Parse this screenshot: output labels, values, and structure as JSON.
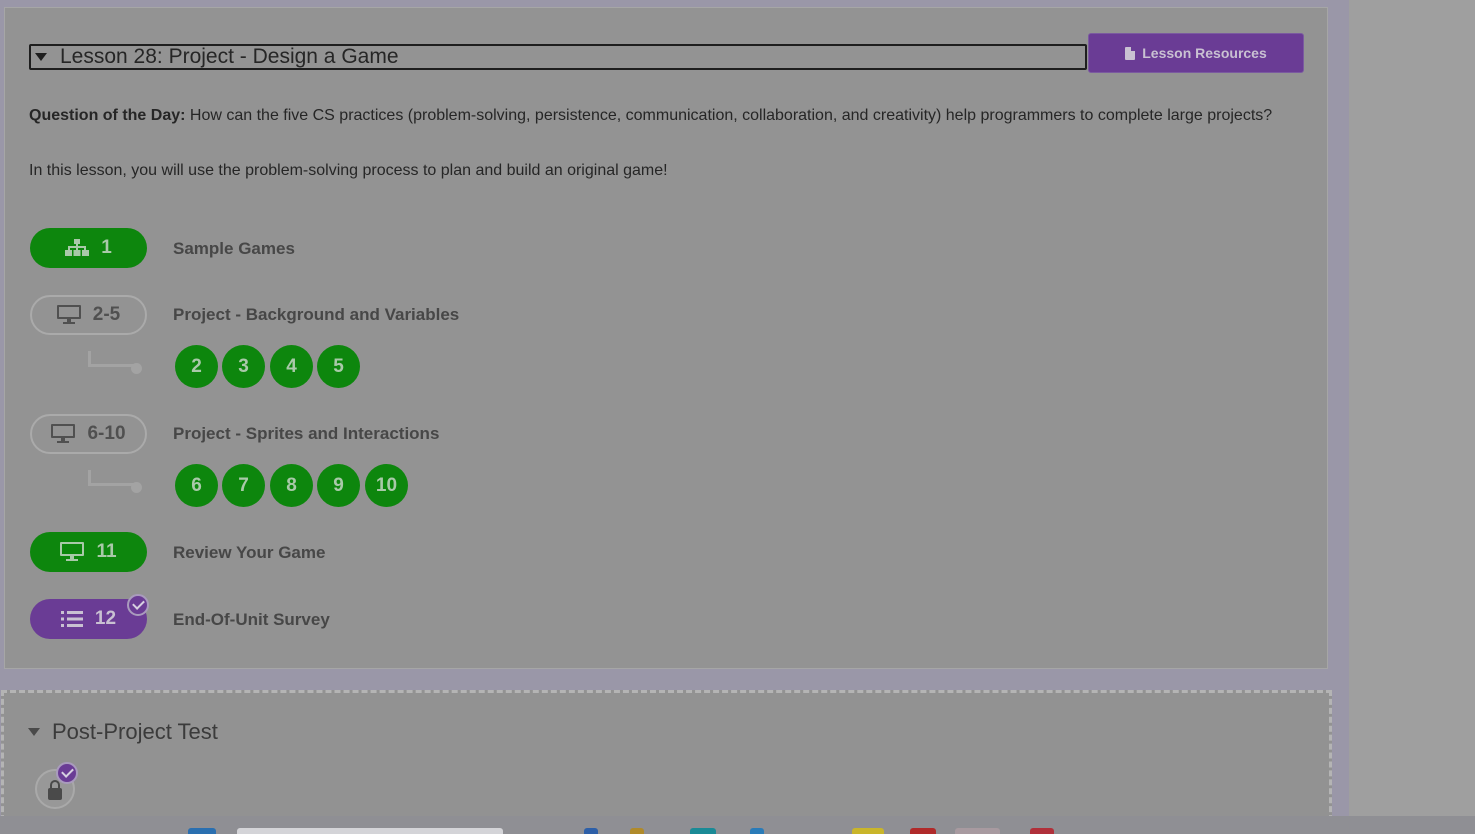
{
  "lesson": {
    "title": "Lesson 28: Project - Design a Game",
    "resources_label": "Lesson Resources",
    "question_label": "Question of the Day:",
    "question_text": " How can the five CS practices (problem-solving, persistence, communication, collaboration, and creativity) help programmers to complete large projects?",
    "intro": "In this lesson, you will use the problem-solving process to plan and build an original game!",
    "levels": [
      {
        "number": "1",
        "label": "Sample Games",
        "icon": "sitemap-icon",
        "style": "green"
      },
      {
        "number": "2-5",
        "label": "Project - Background and Variables",
        "icon": "computer-icon",
        "style": "outline",
        "sublevels": [
          "2",
          "3",
          "4",
          "5"
        ]
      },
      {
        "number": "6-10",
        "label": "Project - Sprites and Interactions",
        "icon": "computer-icon",
        "style": "outline",
        "sublevels": [
          "6",
          "7",
          "8",
          "9",
          "10"
        ]
      },
      {
        "number": "11",
        "label": "Review Your Game",
        "icon": "computer-icon",
        "style": "green"
      },
      {
        "number": "12",
        "label": "End-Of-Unit Survey",
        "icon": "list-icon",
        "style": "purple",
        "checked": true
      }
    ]
  },
  "test": {
    "title": "Post-Project Test",
    "locked": true,
    "checked": true
  },
  "colors": {
    "green": "#0d860d",
    "purple": "#6a3c95"
  }
}
